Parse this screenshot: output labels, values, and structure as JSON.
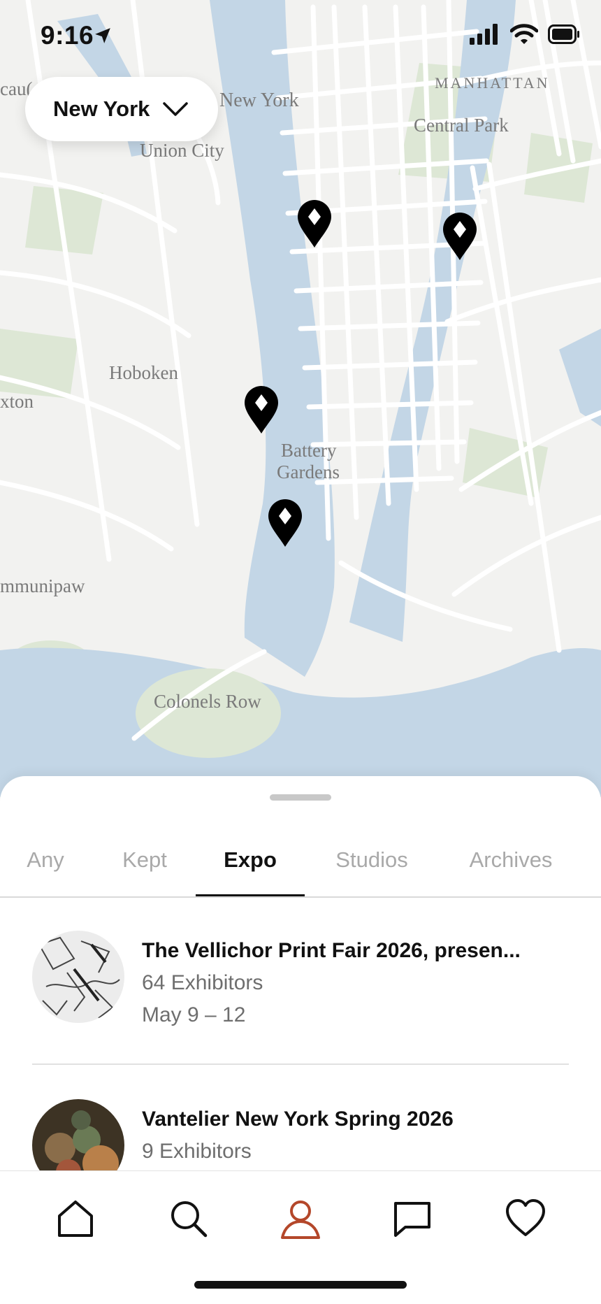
{
  "status_bar": {
    "time": "9:16"
  },
  "map": {
    "labels": {
      "new_york": "New York",
      "manhattan": "MANHATTAN",
      "central_park": "Central Park",
      "union_city": "Union City",
      "hoboken": "Hoboken",
      "battery": "Battery",
      "gardens": "Gardens",
      "colonels_row": "Colonels Row",
      "munipaw": "mmunipaw",
      "paxton": "xton",
      "caul": "cau("
    },
    "pin_count": 4
  },
  "city_selector": {
    "label": "New York",
    "icon": "chevron-down-icon"
  },
  "tabs": [
    {
      "label": "Any",
      "active": false
    },
    {
      "label": "Kept",
      "active": false
    },
    {
      "label": "Expo",
      "active": true
    },
    {
      "label": "Studios",
      "active": false
    },
    {
      "label": "Archives",
      "active": false
    }
  ],
  "listings": [
    {
      "title": "The Vellichor Print Fair 2026, presen...",
      "exhibitors": "64 Exhibitors",
      "dates": "May 9 – 12"
    },
    {
      "title": "Vantelier New York Spring 2026",
      "exhibitors": "9 Exhibitors"
    }
  ],
  "bottom_nav": [
    {
      "icon": "home-icon"
    },
    {
      "icon": "search-icon"
    },
    {
      "icon": "profile-icon",
      "active": true
    },
    {
      "icon": "messages-icon"
    },
    {
      "icon": "heart-icon"
    }
  ],
  "colors": {
    "water": "#c3d6e6",
    "land": "#f2f2f0",
    "park": "#dde7d5",
    "accent": "#b4472a",
    "text": "#111111"
  }
}
